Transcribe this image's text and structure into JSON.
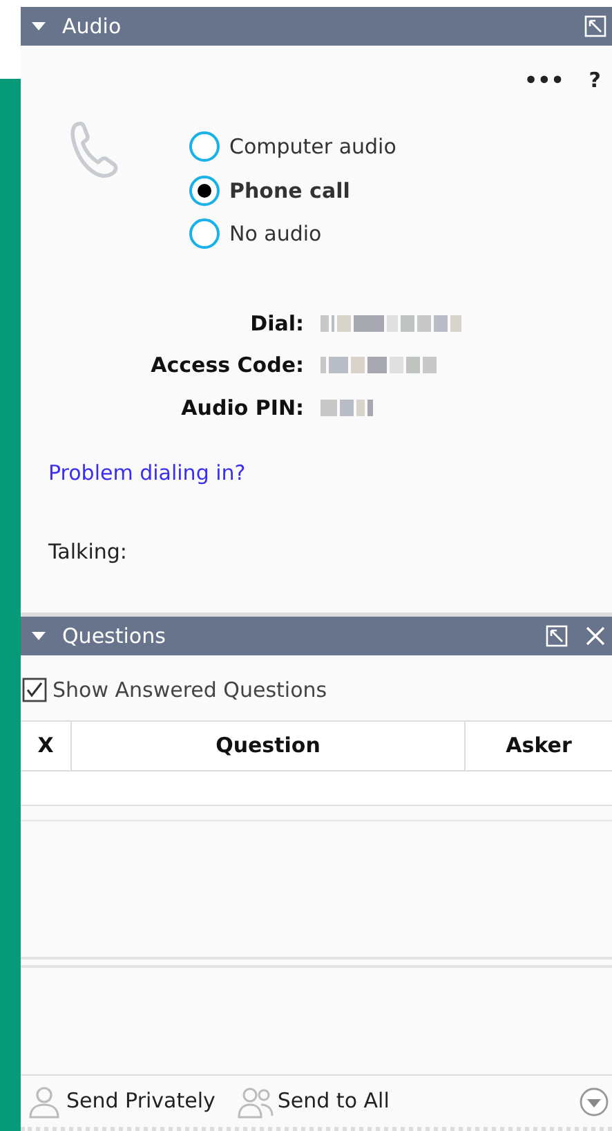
{
  "audio_panel": {
    "title": "Audio",
    "expanded": true,
    "menu": "•••",
    "help": "?",
    "options": [
      {
        "label": "Computer audio",
        "selected": false
      },
      {
        "label": "Phone call",
        "selected": true
      },
      {
        "label": "No audio",
        "selected": false
      }
    ],
    "details": [
      {
        "label": "Dial:"
      },
      {
        "label": "Access Code:"
      },
      {
        "label": "Audio PIN:"
      }
    ],
    "link": "Problem dialing in?",
    "talking": "Talking:"
  },
  "questions_panel": {
    "title": "Questions",
    "expanded": true,
    "show_answered": {
      "label": "Show Answered Questions",
      "checked": true
    },
    "columns": [
      "X",
      "Question",
      "Asker"
    ],
    "actions": [
      {
        "label": "Send Privately",
        "kind": "private"
      },
      {
        "label": "Send to All",
        "kind": "all"
      }
    ]
  }
}
